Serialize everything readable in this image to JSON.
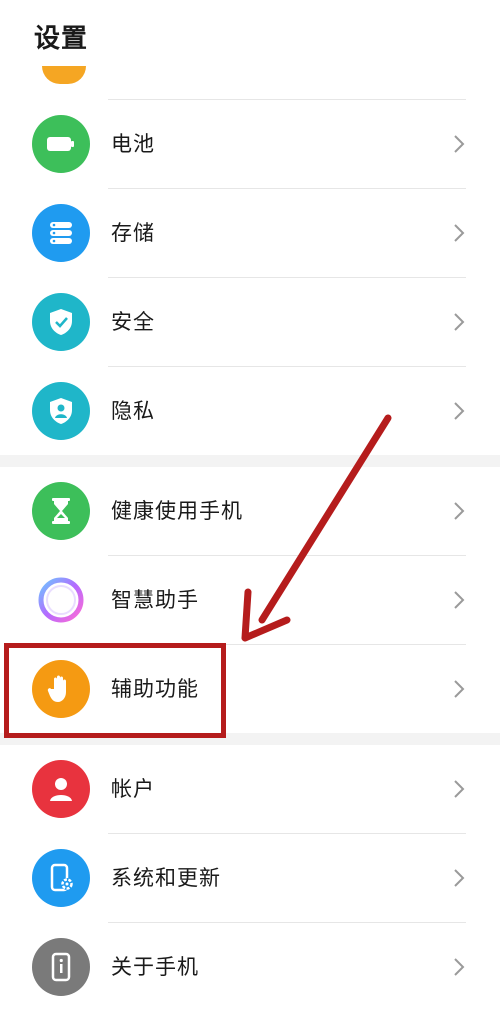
{
  "header": {
    "title": "设置"
  },
  "rows": [
    {
      "label": "电池",
      "icon": "battery-icon",
      "color": "#3dbf5a"
    },
    {
      "label": "存储",
      "icon": "storage-icon",
      "color": "#1f9bf0"
    },
    {
      "label": "安全",
      "icon": "shield-check-icon",
      "color": "#1fb6c9"
    },
    {
      "label": "隐私",
      "icon": "privacy-icon",
      "color": "#1fb6c9"
    },
    {
      "label": "健康使用手机",
      "icon": "hourglass-icon",
      "color": "#3dbf5a"
    },
    {
      "label": "智慧助手",
      "icon": "assistant-ring-icon",
      "color": "#ffffff"
    },
    {
      "label": "辅助功能",
      "icon": "hand-icon",
      "color": "#f59a12"
    },
    {
      "label": "帐户",
      "icon": "user-icon",
      "color": "#e8333e"
    },
    {
      "label": "系统和更新",
      "icon": "phone-gear-icon",
      "color": "#1f9bf0"
    },
    {
      "label": "关于手机",
      "icon": "phone-info-icon",
      "color": "#7a7a7a"
    }
  ],
  "annotation": {
    "highlight_color": "#b51c1c"
  }
}
